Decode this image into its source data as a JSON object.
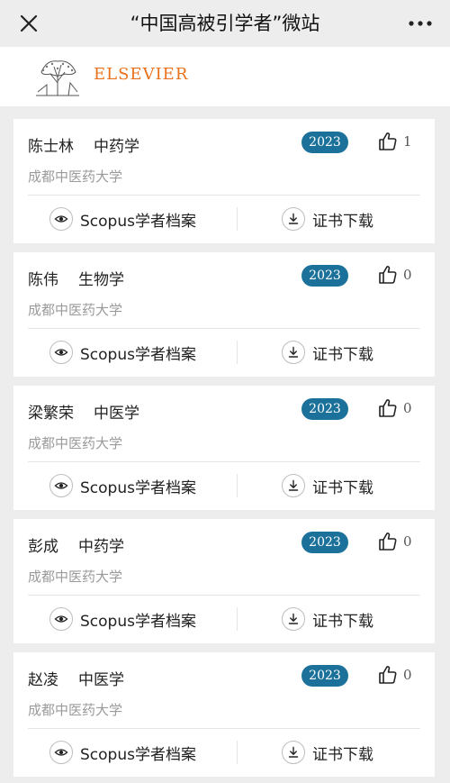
{
  "header": {
    "title": "“中国高被引学者”微站",
    "close_icon": "close-icon",
    "more_icon": "more-dots-icon"
  },
  "brand": {
    "logo_text": "ELSEVIER",
    "logo_color": "#e9711c"
  },
  "colors": {
    "badge_bg": "#1b7199",
    "page_bg": "#ededed"
  },
  "scholars": [
    {
      "name": "陈士林",
      "field": "中药学",
      "institution": "成都中医药大学",
      "year": "2023",
      "likes": "1",
      "scopus_label": "Scopus学者档案",
      "cert_label": "证书下载"
    },
    {
      "name": "陈伟",
      "field": "生物学",
      "institution": "成都中医药大学",
      "year": "2023",
      "likes": "0",
      "scopus_label": "Scopus学者档案",
      "cert_label": "证书下载"
    },
    {
      "name": "梁繁荣",
      "field": "中医学",
      "institution": "成都中医药大学",
      "year": "2023",
      "likes": "0",
      "scopus_label": "Scopus学者档案",
      "cert_label": "证书下载"
    },
    {
      "name": "彭成",
      "field": "中药学",
      "institution": "成都中医药大学",
      "year": "2023",
      "likes": "0",
      "scopus_label": "Scopus学者档案",
      "cert_label": "证书下载"
    },
    {
      "name": "赵凌",
      "field": "中医学",
      "institution": "成都中医药大学",
      "year": "2023",
      "likes": "0",
      "scopus_label": "Scopus学者档案",
      "cert_label": "证书下载"
    }
  ]
}
